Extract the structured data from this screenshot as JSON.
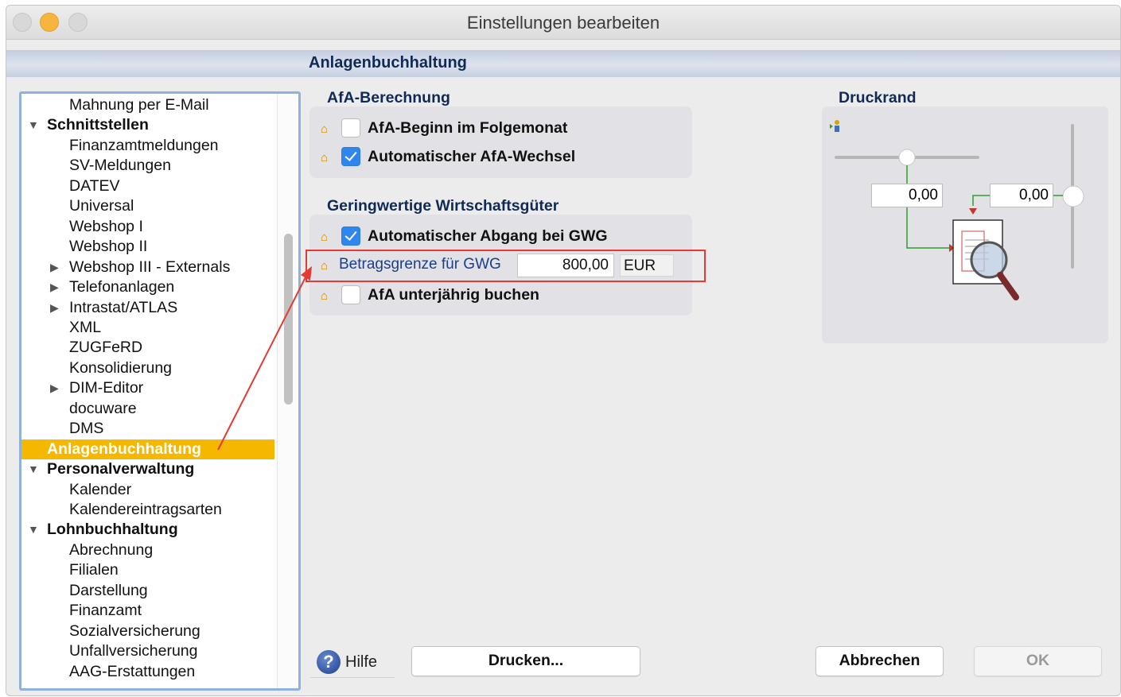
{
  "window": {
    "title": "Einstellungen bearbeiten"
  },
  "section": {
    "title": "Anlagenbuchhaltung"
  },
  "tree": {
    "items": [
      {
        "label": "Mahnung per E-Mail",
        "level": 2,
        "arrow": ""
      },
      {
        "label": "Schnittstellen",
        "level": 1,
        "arrow": "▼"
      },
      {
        "label": "Finanzamtmeldungen",
        "level": 2,
        "arrow": ""
      },
      {
        "label": "SV-Meldungen",
        "level": 2,
        "arrow": ""
      },
      {
        "label": "DATEV",
        "level": 2,
        "arrow": ""
      },
      {
        "label": "Universal",
        "level": 2,
        "arrow": ""
      },
      {
        "label": "Webshop I",
        "level": 2,
        "arrow": ""
      },
      {
        "label": "Webshop II",
        "level": 2,
        "arrow": ""
      },
      {
        "label": "Webshop III - Externals",
        "level": 2,
        "arrow": "▶"
      },
      {
        "label": "Telefonanlagen",
        "level": 2,
        "arrow": "▶"
      },
      {
        "label": "Intrastat/ATLAS",
        "level": 2,
        "arrow": "▶"
      },
      {
        "label": "XML",
        "level": 2,
        "arrow": ""
      },
      {
        "label": "ZUGFeRD",
        "level": 2,
        "arrow": ""
      },
      {
        "label": "Konsolidierung",
        "level": 2,
        "arrow": ""
      },
      {
        "label": "DIM-Editor",
        "level": 2,
        "arrow": "▶"
      },
      {
        "label": "docuware",
        "level": 2,
        "arrow": ""
      },
      {
        "label": "DMS",
        "level": 2,
        "arrow": ""
      },
      {
        "label": "Anlagenbuchhaltung",
        "level": 1,
        "arrow": "",
        "selected": true
      },
      {
        "label": "Personalverwaltung",
        "level": 1,
        "arrow": "▼"
      },
      {
        "label": "Kalender",
        "level": 2,
        "arrow": ""
      },
      {
        "label": "Kalendereintragsarten",
        "level": 2,
        "arrow": ""
      },
      {
        "label": "Lohnbuchhaltung",
        "level": 1,
        "arrow": "▼"
      },
      {
        "label": "Abrechnung",
        "level": 2,
        "arrow": ""
      },
      {
        "label": "Filialen",
        "level": 2,
        "arrow": ""
      },
      {
        "label": "Darstellung",
        "level": 2,
        "arrow": ""
      },
      {
        "label": "Finanzamt",
        "level": 2,
        "arrow": ""
      },
      {
        "label": "Sozialversicherung",
        "level": 2,
        "arrow": ""
      },
      {
        "label": "Unfallversicherung",
        "level": 2,
        "arrow": ""
      },
      {
        "label": "AAG-Erstattungen",
        "level": 2,
        "arrow": ""
      }
    ]
  },
  "afa": {
    "title": "AfA-Berechnung",
    "beginn_label": "AfA-Beginn im Folgemonat",
    "beginn_checked": false,
    "wechsel_label": "Automatischer AfA-Wechsel",
    "wechsel_checked": true
  },
  "gwg": {
    "title": "Geringwertige Wirtschaftsgüter",
    "abgang_label": "Automatischer Abgang bei GWG",
    "abgang_checked": true,
    "grenze_label": "Betragsgrenze für GWG",
    "grenze_value": "800,00",
    "grenze_unit": "EUR",
    "unterjaehrig_label": "AfA unterjährig buchen",
    "unterjaehrig_checked": false
  },
  "druckrand": {
    "title": "Druckrand",
    "top_value": "0,00",
    "right_value": "0,00"
  },
  "footer": {
    "help_label": "Hilfe",
    "print_label": "Drucken...",
    "cancel_label": "Abbrechen",
    "ok_label": "OK"
  },
  "colors": {
    "selection": "#f6b700",
    "accent_blue": "#2f86ef",
    "annotation_red": "#e53935",
    "header_text": "#102a55"
  }
}
